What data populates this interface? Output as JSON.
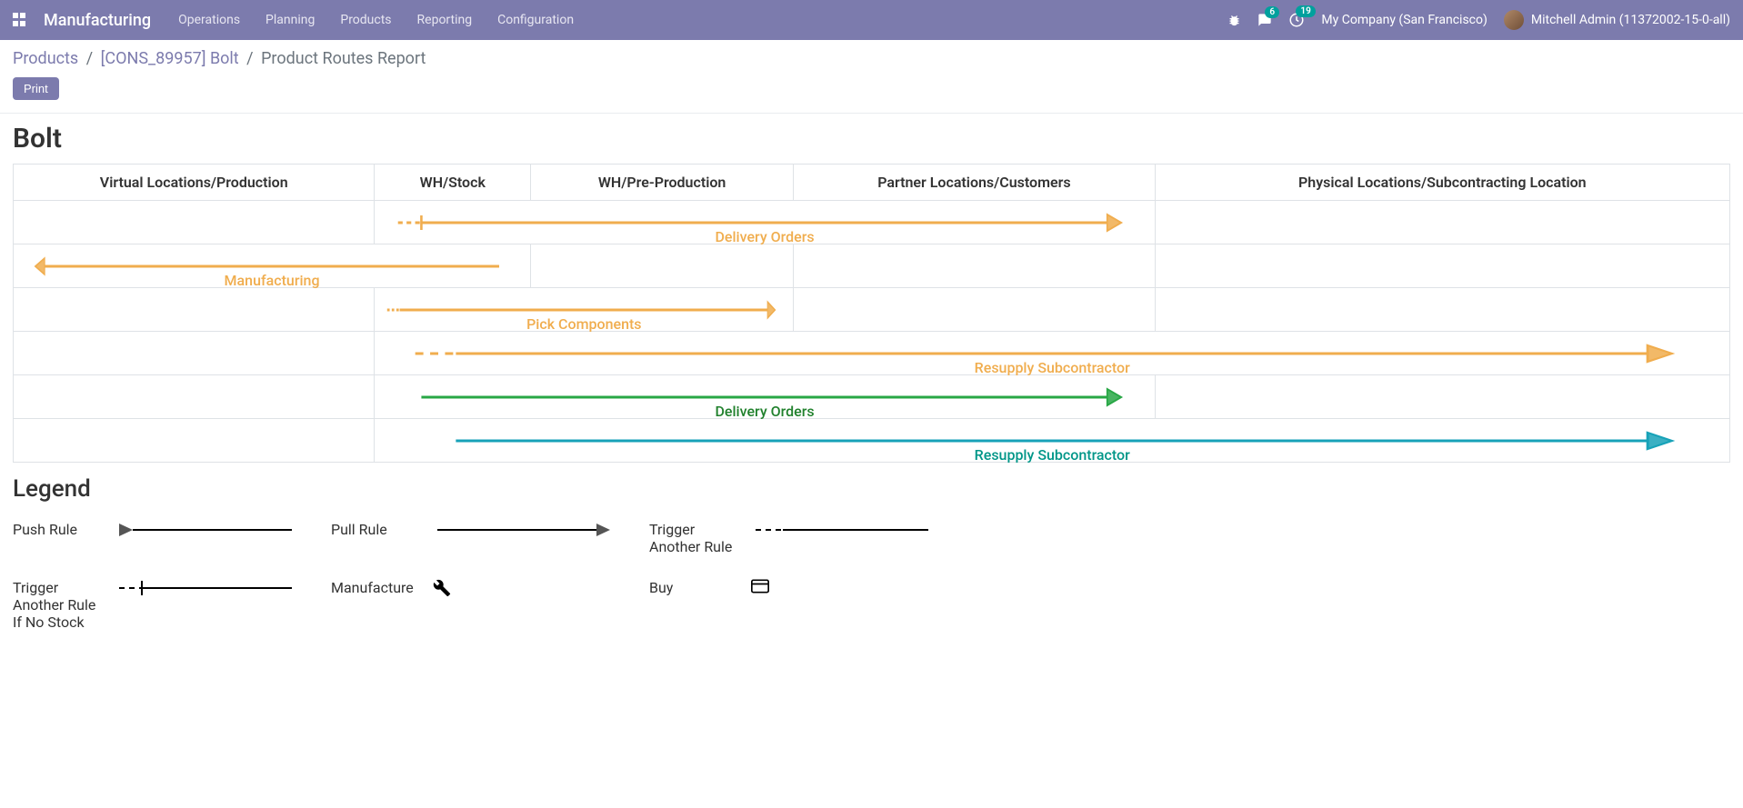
{
  "navbar": {
    "brand": "Manufacturing",
    "menu": [
      "Operations",
      "Planning",
      "Products",
      "Reporting",
      "Configuration"
    ],
    "messages_count": "6",
    "activities_count": "19",
    "company": "My Company (San Francisco)",
    "user": "Mitchell Admin (11372002-15-0-all)"
  },
  "breadcrumb": {
    "items": [
      "Products",
      "[CONS_89957] Bolt"
    ],
    "current": "Product Routes Report"
  },
  "buttons": {
    "print": "Print"
  },
  "report": {
    "title": "Bolt",
    "columns": [
      "Virtual Locations/Production",
      "WH/Stock",
      "WH/Pre-Production",
      "Partner Locations/Customers",
      "Physical Locations/Subcontracting Location"
    ],
    "routes": [
      {
        "label": "Delivery Orders",
        "color": "orange",
        "from_col": 1,
        "to_col": 3,
        "direction": "right",
        "start_style": "bar_dashed"
      },
      {
        "label": "Manufacturing",
        "color": "orange",
        "from_col": 1,
        "to_col": 0,
        "direction": "left",
        "start_style": "solid"
      },
      {
        "label": "Pick Components",
        "color": "orange",
        "from_col": 1,
        "to_col": 2,
        "direction": "right",
        "start_style": "dashed"
      },
      {
        "label": "Resupply Subcontractor",
        "color": "orange",
        "from_col": 1,
        "to_col": 4,
        "direction": "right",
        "start_style": "dashed"
      },
      {
        "label": "Delivery Orders",
        "color": "green",
        "from_col": 1,
        "to_col": 3,
        "direction": "right",
        "start_style": "solid"
      },
      {
        "label": "Resupply Subcontractor",
        "color": "teal",
        "from_col": 1,
        "to_col": 4,
        "direction": "right",
        "start_style": "solid"
      }
    ]
  },
  "legend": {
    "title": "Legend",
    "items": [
      {
        "label": "Push Rule",
        "type": "push"
      },
      {
        "label": "Pull Rule",
        "type": "pull"
      },
      {
        "label": "Trigger Another Rule",
        "type": "trigger-dashed",
        "multiline": [
          "Trigger",
          "Another Rule"
        ]
      },
      {
        "label": "Trigger Another Rule If No Stock",
        "type": "trigger-bar",
        "multiline": [
          "Trigger",
          "Another Rule",
          "If No Stock"
        ]
      },
      {
        "label": "Manufacture",
        "type": "manufacture"
      },
      {
        "label": "Buy",
        "type": "buy"
      }
    ]
  }
}
